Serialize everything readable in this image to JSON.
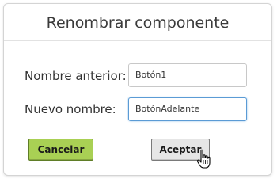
{
  "dialog": {
    "title": "Renombrar componente",
    "old_name": {
      "label": "Nombre anterior:",
      "value": "Botón1"
    },
    "new_name": {
      "label": "Nuevo nombre:",
      "value": "BotónAdelante"
    },
    "buttons": {
      "cancel_label": "Cancelar",
      "accept_label": "Aceptar"
    },
    "colors": {
      "cancel_bg": "#a9d054",
      "accept_bg": "#e6e6e6",
      "focus_border": "#5b9bd5"
    },
    "cursor_icon": "hand-pointer-icon"
  }
}
